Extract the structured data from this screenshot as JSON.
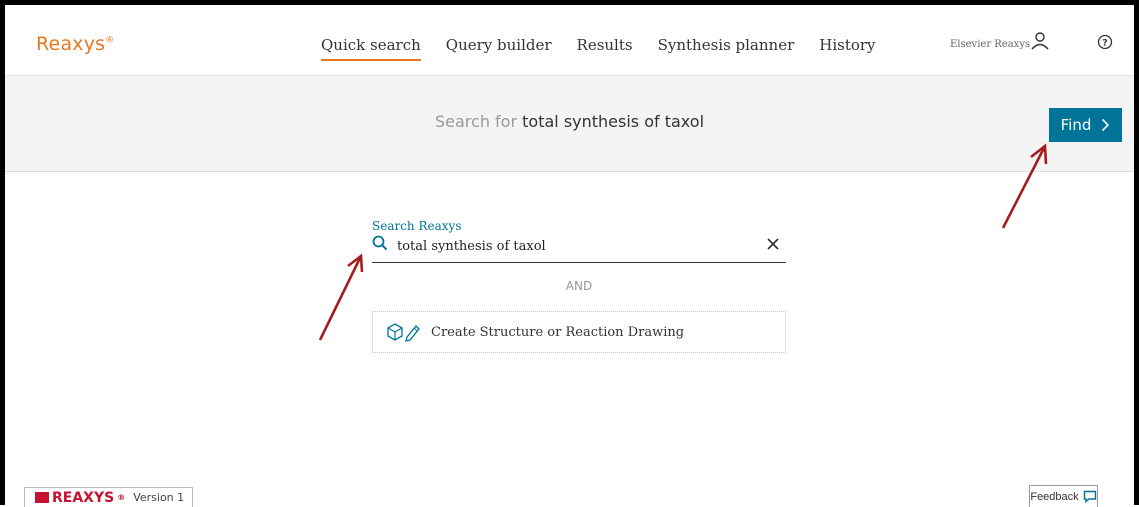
{
  "header": {
    "logo": "Reaxys",
    "logo_mark": "®",
    "nav": [
      "Quick search",
      "Query builder",
      "Results",
      "Synthesis planner",
      "History"
    ],
    "active_tab": "Quick search",
    "user_label": "Elsevier Reaxys",
    "user_icon": "user-icon",
    "help_icon": "help-icon"
  },
  "band": {
    "prefix": "Search for",
    "query": "total synthesis of taxol",
    "find_label": "Find"
  },
  "search": {
    "label": "Search Reaxys",
    "value": "total synthesis of taxol",
    "and_label": "AND",
    "draw_label": "Create Structure or Reaction Drawing"
  },
  "footer": {
    "brand": "REAXYS",
    "brand_mark": "®",
    "version": "Version 1",
    "feedback": "Feedback"
  },
  "colors": {
    "accent": "#e87722",
    "primary": "#007398",
    "annotation_arrow": "#a31f1f"
  }
}
